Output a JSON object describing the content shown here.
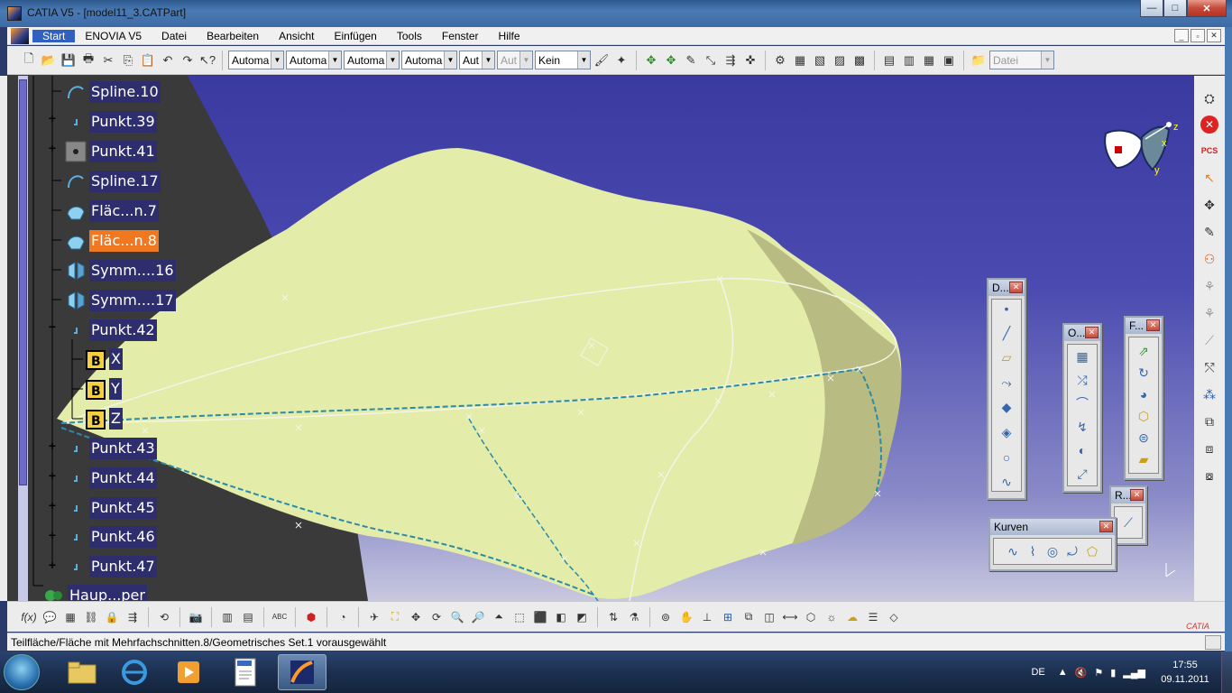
{
  "window": {
    "title": "CATIA V5 - [model11_3.CATPart]",
    "buttons": {
      "minimize": "—",
      "maximize": "□",
      "close": "✕"
    }
  },
  "menu": {
    "items": [
      "Start",
      "ENOVIA V5",
      "Datei",
      "Bearbeiten",
      "Ansicht",
      "Einfügen",
      "Tools",
      "Fenster",
      "Hilfe"
    ],
    "right_buttons": [
      "_",
      "▫",
      "✕"
    ]
  },
  "toolbar": {
    "combos": [
      "Automa",
      "Automa",
      "Automa",
      "Automa",
      "Aut",
      "Aut",
      "Kein"
    ],
    "file_combo": "Datei"
  },
  "tree": {
    "items": [
      {
        "label": "Spline.10",
        "icon": "spline-icon",
        "selected": false
      },
      {
        "label": "Punkt.39",
        "icon": "point-icon",
        "selected": false
      },
      {
        "label": "Punkt.41",
        "icon": "point-pattern-icon",
        "selected": false
      },
      {
        "label": "Spline.17",
        "icon": "spline-icon",
        "selected": false
      },
      {
        "label": "Fläc...n.7",
        "icon": "surface-icon",
        "selected": false
      },
      {
        "label": "Fläc...n.8",
        "icon": "surface-icon",
        "selected": true
      },
      {
        "label": "Symm....16",
        "icon": "symmetry-icon",
        "selected": false
      },
      {
        "label": "Symm....17",
        "icon": "symmetry-icon",
        "selected": false
      },
      {
        "label": "Punkt.42",
        "icon": "point-icon",
        "selected": false
      },
      {
        "label": "X",
        "icon": "parameter-b-icon",
        "selected": false
      },
      {
        "label": "Y",
        "icon": "parameter-b-icon",
        "selected": false
      },
      {
        "label": "Z",
        "icon": "parameter-b-icon",
        "selected": false
      },
      {
        "label": "Punkt.43",
        "icon": "point-icon",
        "selected": false
      },
      {
        "label": "Punkt.44",
        "icon": "point-icon",
        "selected": false
      },
      {
        "label": "Punkt.45",
        "icon": "point-icon",
        "selected": false
      },
      {
        "label": "Punkt.46",
        "icon": "point-icon",
        "selected": false
      },
      {
        "label": "Punkt.47",
        "icon": "point-icon",
        "selected": false
      },
      {
        "label": "Haup...per",
        "icon": "main-body-icon",
        "selected": false
      }
    ]
  },
  "floating_toolbars": {
    "draht": "D...",
    "operationen": "O...",
    "flaechen": "F...",
    "r": "R...",
    "kurven": "Kurven"
  },
  "compass": {
    "x": "x",
    "y": "y",
    "z": "z"
  },
  "status": {
    "text": "Teilfläche/Fläche mit Mehrfachschnitten.8/Geometrisches Set.1 vorausgewählt"
  },
  "taskbar": {
    "language": "DE",
    "time": "17:55",
    "date": "09.11.2011"
  },
  "logo": {
    "text": "CATIA"
  },
  "colors": {
    "selection": "#f07820",
    "tree_label_bg": "#2e2e6e",
    "surface": "#e4ecaa"
  }
}
